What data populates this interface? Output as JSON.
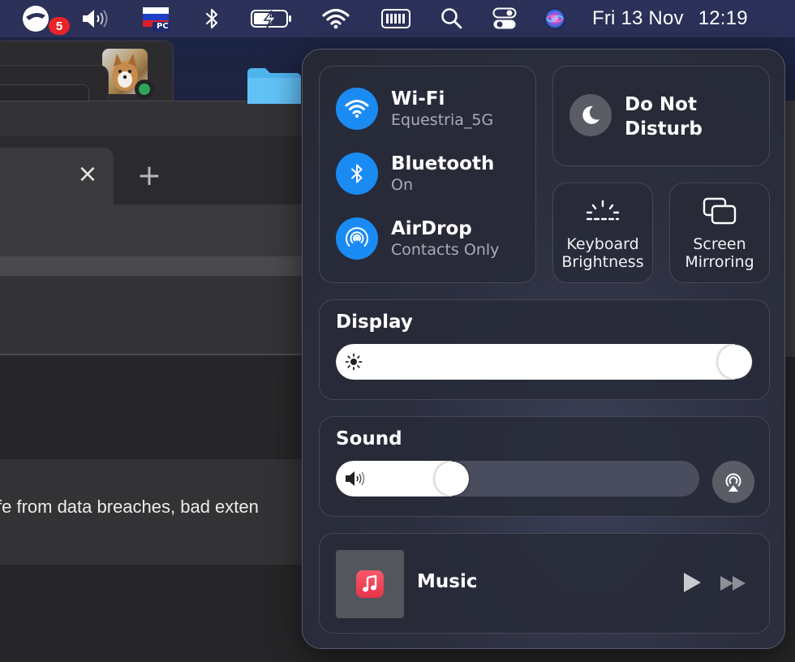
{
  "menubar": {
    "notification_count": "5",
    "input_source_label": "PC",
    "date": "Fri 13 Nov",
    "time": "12:19"
  },
  "browser": {
    "tab_close": "×",
    "new_tab": "+",
    "page_text": "fe from data breaches, bad exten"
  },
  "control_center": {
    "network": {
      "wifi": {
        "title": "Wi-Fi",
        "subtitle": "Equestria_5G"
      },
      "bluetooth": {
        "title": "Bluetooth",
        "subtitle": "On"
      },
      "airdrop": {
        "title": "AirDrop",
        "subtitle": "Contacts Only"
      }
    },
    "do_not_disturb": {
      "line1": "Do Not",
      "line2": "Disturb"
    },
    "keyboard_brightness": {
      "line1": "Keyboard",
      "line2": "Brightness"
    },
    "screen_mirroring": {
      "line1": "Screen",
      "line2": "Mirroring"
    },
    "display": {
      "title": "Display",
      "level": 1.0
    },
    "sound": {
      "title": "Sound",
      "level": 0.3
    },
    "music": {
      "title": "Music"
    }
  },
  "colors": {
    "menubar": "#2b3158",
    "accent_blue": "#1a8bf3",
    "badge_red": "#e8232a",
    "music_red": "#f1445a"
  },
  "icons": {
    "menubar": [
      "notification-app-icon",
      "volume-icon",
      "russian-flag-icon",
      "bluetooth-icon",
      "battery-charging-icon",
      "wifi-icon",
      "keyboard-icon",
      "search-icon",
      "control-center-icon",
      "siri-icon"
    ],
    "control_center": [
      "wifi-icon",
      "bluetooth-icon",
      "airdrop-icon",
      "moon-icon",
      "keyboard-brightness-icon",
      "screen-mirroring-icon",
      "sun-icon",
      "speaker-icon",
      "airplay-audio-icon",
      "music-note-icon",
      "play-icon",
      "fast-forward-icon"
    ]
  }
}
